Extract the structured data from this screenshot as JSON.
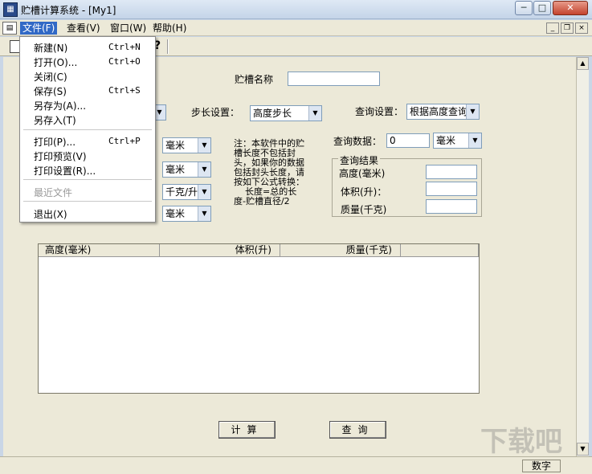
{
  "window": {
    "title": "贮槽计算系统 - [My1]",
    "icon": "app-icon",
    "controls": {
      "minimize": "─",
      "maximize": "□",
      "close": "✕"
    }
  },
  "menubar": {
    "items": [
      {
        "label": "文件(F)"
      },
      {
        "label": "查看(V)"
      },
      {
        "label": "窗口(W)"
      },
      {
        "label": "帮助(H)"
      }
    ],
    "mdi_controls": {
      "minimize": "_",
      "restore": "❐",
      "close": "×"
    }
  },
  "toolbar": {
    "help_icon": "?"
  },
  "file_menu": {
    "items": [
      {
        "label": "新建(N)",
        "shortcut": "Ctrl+N"
      },
      {
        "label": "打开(O)...",
        "shortcut": "Ctrl+O"
      },
      {
        "label": "关闭(C)",
        "shortcut": ""
      },
      {
        "label": "保存(S)",
        "shortcut": "Ctrl+S"
      },
      {
        "label": "另存为(A)...",
        "shortcut": ""
      },
      {
        "label": "另存入(T)",
        "shortcut": ""
      },
      {
        "label": "打印(P)...",
        "shortcut": "Ctrl+P"
      },
      {
        "label": "打印预览(V)",
        "shortcut": ""
      },
      {
        "label": "打印设置(R)...",
        "shortcut": ""
      },
      {
        "label": "最近文件",
        "shortcut": ""
      },
      {
        "label": "退出(X)",
        "shortcut": ""
      }
    ]
  },
  "form": {
    "tank_name_label": "贮槽名称",
    "tank_name_value": "",
    "step_label": "步长设置：",
    "step_value": "高度步长",
    "query_setting_label": "查询设置：",
    "query_setting_value": "根据高度查询",
    "unit_combos": [
      "毫米",
      "毫米",
      "千克/升",
      "毫米"
    ],
    "query_data_label": "查询数据：",
    "query_data_value": "0",
    "query_unit": "毫米",
    "note": "注：本软件中的贮槽长度不包括封头，如果你的数据包括封头长度，请按如下公式转换：\n    长度=总的长度-贮槽直径/2",
    "result_title": "查询结果",
    "result_height_label": "高度(毫米)",
    "result_volume_label": "体积(升)：",
    "result_mass_label": "质量(千克)",
    "result_height_value": "",
    "result_volume_value": "",
    "result_mass_value": ""
  },
  "table": {
    "columns": [
      "高度(毫米)",
      "体积(升)",
      "质量(千克)"
    ]
  },
  "buttons": {
    "calculate": "计算",
    "query": "查询"
  },
  "statusbar": {
    "num_indicator": "数字"
  },
  "watermark": "下载吧"
}
